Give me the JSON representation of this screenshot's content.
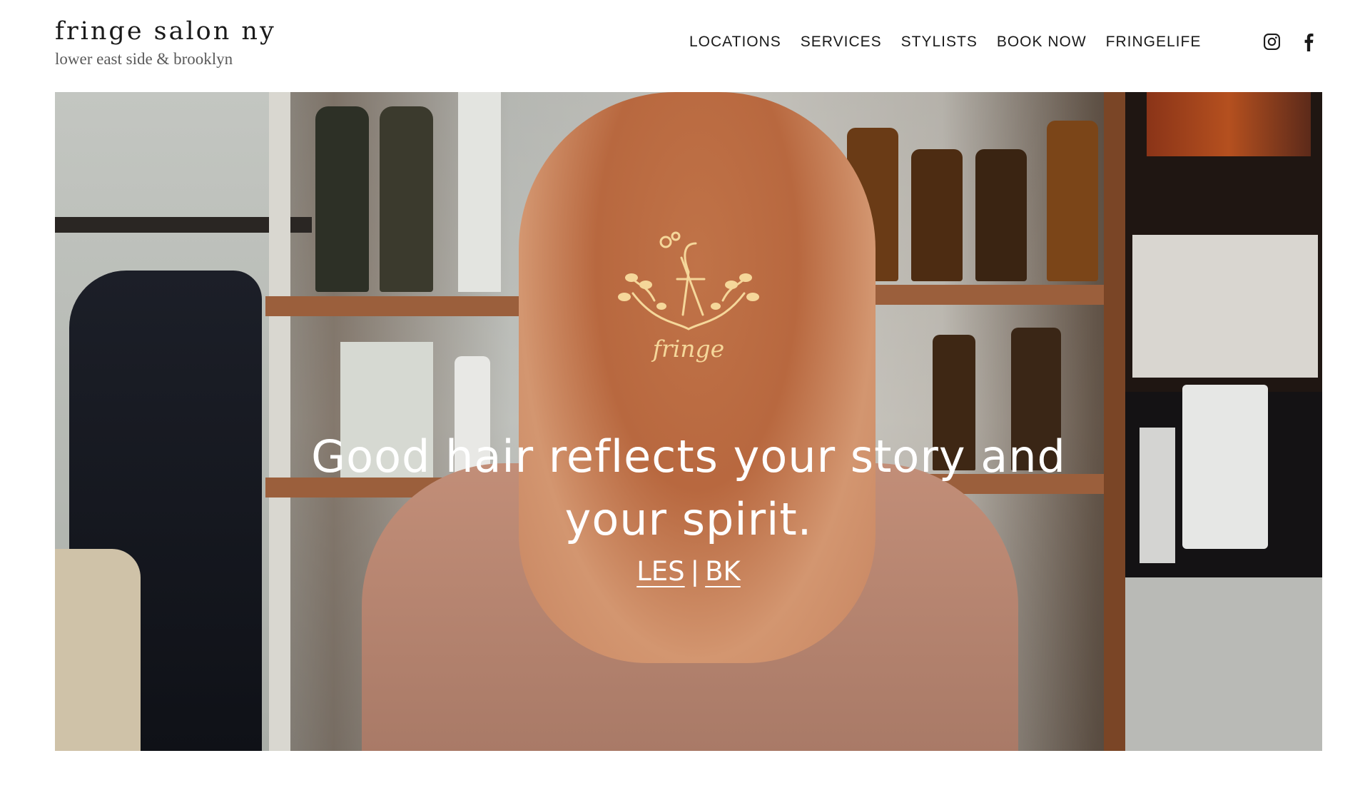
{
  "brand": {
    "title": "fringe salon ny",
    "tagline": "lower east side & brooklyn"
  },
  "nav": {
    "items": [
      "LOCATIONS",
      "SERVICES",
      "STYLISTS",
      "BOOK NOW",
      "FRINGELIFE"
    ]
  },
  "social": {
    "instagram_icon": "instagram-icon",
    "facebook_icon": "facebook-icon"
  },
  "hero": {
    "logo_word": "fringe",
    "headline_line1": "Good hair reflects your story and",
    "headline_line2": "your spirit.",
    "link_les": "LES",
    "separator": "|",
    "link_bk": "BK"
  },
  "colors": {
    "logo_gold": "#f5d79a",
    "hair": "#c97f55",
    "shirt": "#b88672",
    "text_white": "#ffffff"
  }
}
